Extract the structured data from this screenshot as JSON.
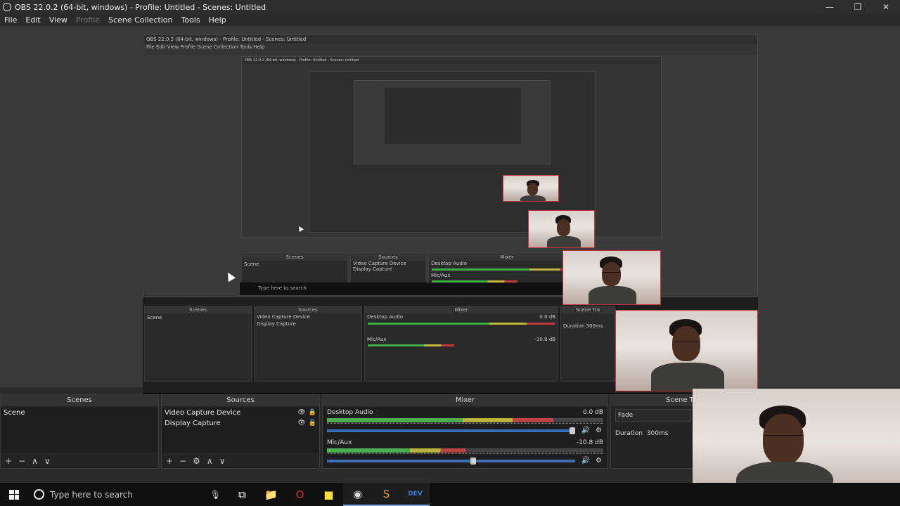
{
  "window": {
    "title": "OBS 22.0.2 (64-bit, windows) - Profile: Untitled - Scenes: Untitled",
    "min": "—",
    "restore": "❐",
    "close": "✕"
  },
  "menu": [
    {
      "label": "File",
      "enabled": true
    },
    {
      "label": "Edit",
      "enabled": true
    },
    {
      "label": "View",
      "enabled": true
    },
    {
      "label": "Profile",
      "enabled": false
    },
    {
      "label": "Scene Collection",
      "enabled": true
    },
    {
      "label": "Tools",
      "enabled": true
    },
    {
      "label": "Help",
      "enabled": true
    }
  ],
  "nested_preview": {
    "title": "OBS 22.0.2 (64-bit, windows) - Profile: Untitled - Scenes: Untitled",
    "menu": "File  Edit  View  Profile  Scene Collection  Tools  Help",
    "scenes_header": "Scenes",
    "sources_header": "Sources",
    "mixer_header": "Mixer",
    "transitions_header": "Scene Tra",
    "scene_item": "Scene",
    "source_1": "Video Capture Device",
    "source_2": "Display Capture",
    "desktop_audio": "Desktop Audio",
    "desktop_db": "0.0 dB",
    "mic_aux": "Mic/Aux",
    "mic_db": "-10.8 dB",
    "duration_label": "Duration",
    "duration_value": "300ms",
    "search_text": "Type here to search"
  },
  "scenes": {
    "header": "Scenes",
    "items": [
      "Scene"
    ]
  },
  "sources": {
    "header": "Sources",
    "items": [
      "Video Capture Device",
      "Display Capture"
    ]
  },
  "mixer": {
    "header": "Mixer",
    "channels": [
      {
        "name": "Desktop Audio",
        "db": "0.0 dB",
        "level": 0.82,
        "fader": 1.0
      },
      {
        "name": "Mic/Aux",
        "db": "-10.8 dB",
        "level": 0.5,
        "fader": 0.6
      }
    ]
  },
  "transitions": {
    "header": "Scene Tra",
    "type": "Fade",
    "duration_label": "Duration",
    "duration_value": "300ms"
  },
  "dock_icons": {
    "add": "+",
    "remove": "−",
    "gear": "⚙",
    "up": "∧",
    "down": "∨",
    "eye": "👁",
    "lock": "🔒",
    "mute": "🔊"
  },
  "taskbar": {
    "search_placeholder": "Type here to search",
    "mic": "🎙",
    "icons": [
      {
        "name": "task-view-icon",
        "glyph": "⧉",
        "active": false,
        "color": "#ffffff"
      },
      {
        "name": "file-explorer-icon",
        "glyph": "📁",
        "active": false,
        "color": "#f2c94c"
      },
      {
        "name": "opera-icon",
        "glyph": "O",
        "active": false,
        "color": "#e32636"
      },
      {
        "name": "sticky-notes-icon",
        "glyph": "■",
        "active": false,
        "color": "#f7e03c"
      },
      {
        "name": "obs-icon",
        "glyph": "◉",
        "active": true,
        "color": "#dddddd"
      },
      {
        "name": "sublime-icon",
        "glyph": "S",
        "active": true,
        "color": "#f29b38"
      },
      {
        "name": "dev-tool-icon",
        "glyph": "DEV",
        "active": true,
        "color": "#3b78d8"
      }
    ]
  }
}
